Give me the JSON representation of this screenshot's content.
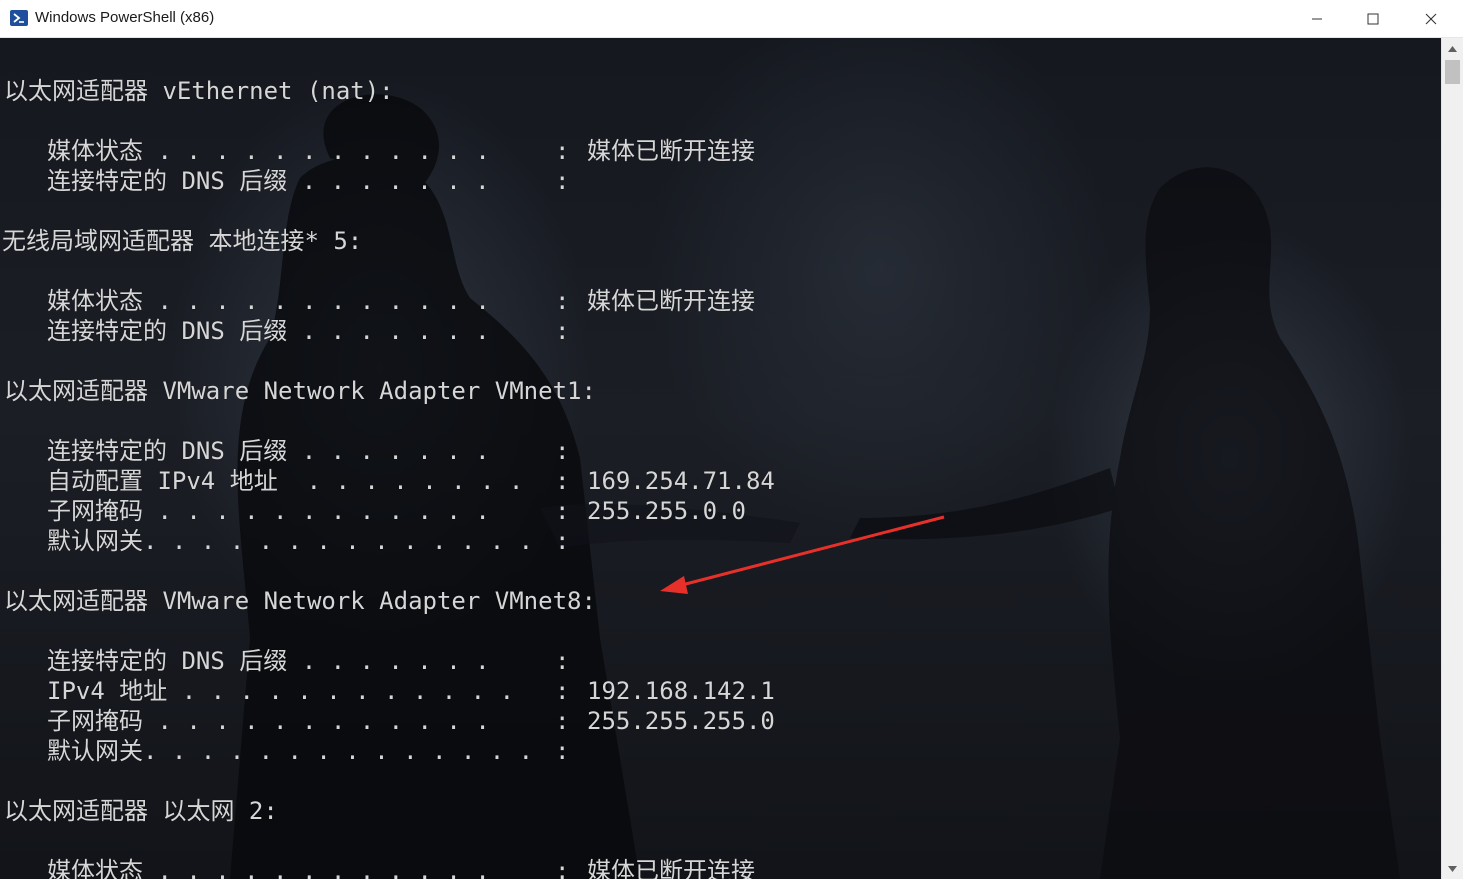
{
  "window": {
    "title": "Windows PowerShell (x86)",
    "icon": "powershell-icon",
    "controls": {
      "minimize": "minimize-icon",
      "maximize": "maximize-icon",
      "close": "close-icon"
    }
  },
  "console": {
    "lines": [
      {
        "type": "header",
        "text": "以太网适配器 vEthernet (nat):"
      },
      {
        "type": "entry",
        "label": "媒体状态",
        "dots": " . . . . . . . . . . . .",
        "value": "媒体已断开连接"
      },
      {
        "type": "entry",
        "label": "连接特定的 DNS 后缀",
        "dots": " . . . . . . .",
        "value": ""
      },
      {
        "type": "header",
        "text": "无线局域网适配器 本地连接* 5:"
      },
      {
        "type": "entry",
        "label": "媒体状态",
        "dots": " . . . . . . . . . . . .",
        "value": "媒体已断开连接"
      },
      {
        "type": "entry",
        "label": "连接特定的 DNS 后缀",
        "dots": " . . . . . . .",
        "value": ""
      },
      {
        "type": "header",
        "text": "以太网适配器 VMware Network Adapter VMnet1:"
      },
      {
        "type": "entry",
        "label": "连接特定的 DNS 后缀",
        "dots": " . . . . . . .",
        "value": ""
      },
      {
        "type": "entry",
        "label": "自动配置 IPv4 地址",
        "dots": "  . . . . . . . .",
        "value": "169.254.71.84"
      },
      {
        "type": "entry",
        "label": "子网掩码",
        "dots": " . . . . . . . . . . . .",
        "value": "255.255.0.0"
      },
      {
        "type": "entry",
        "label": "默认网关.",
        "dots": " . . . . . . . . . . . . .",
        "value": ""
      },
      {
        "type": "header",
        "text": "以太网适配器 VMware Network Adapter VMnet8:"
      },
      {
        "type": "entry",
        "label": "连接特定的 DNS 后缀",
        "dots": " . . . . . . .",
        "value": ""
      },
      {
        "type": "entry",
        "label": "IPv4 地址",
        "dots": " . . . . . . . . . . . .",
        "value": "192.168.142.1"
      },
      {
        "type": "entry",
        "label": "子网掩码",
        "dots": " . . . . . . . . . . . .",
        "value": "255.255.255.0"
      },
      {
        "type": "entry",
        "label": "默认网关.",
        "dots": " . . . . . . . . . . . . .",
        "value": ""
      },
      {
        "type": "header",
        "text": "以太网适配器 以太网 2:"
      },
      {
        "type": "entry",
        "label": "媒体状态",
        "dots": " . . . . . . . . . . . .",
        "value": "媒体已断开连接"
      }
    ]
  },
  "colors": {
    "console_text": "#d6d6d6",
    "annotation_arrow": "#e8302a"
  }
}
